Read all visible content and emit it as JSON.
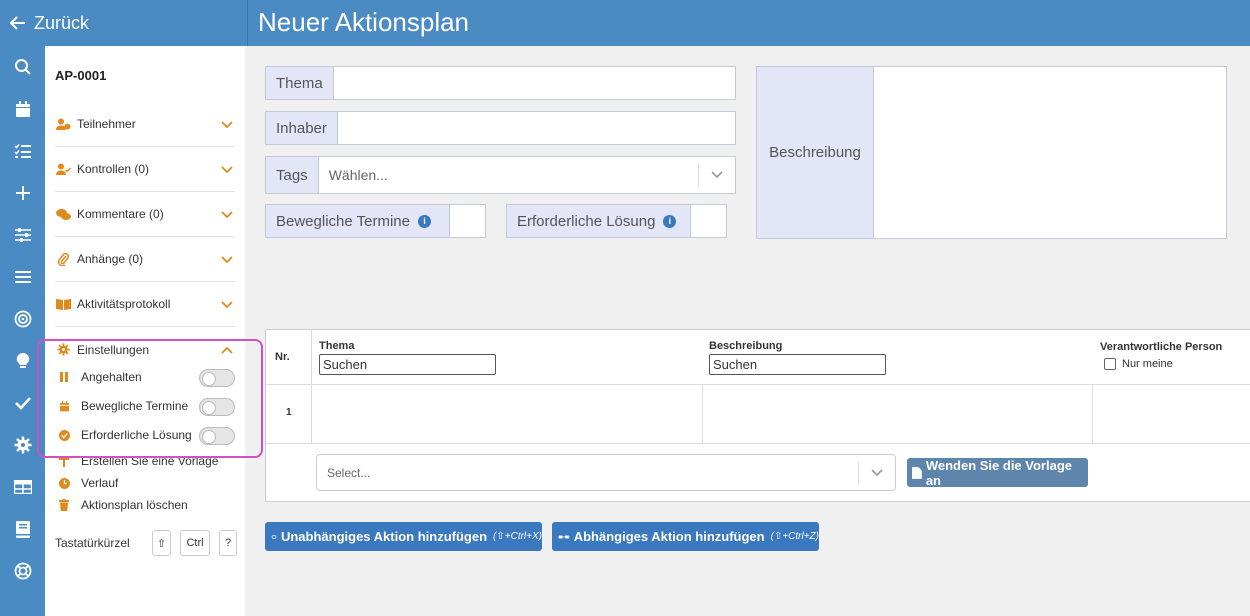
{
  "header": {
    "back_label": "Zurück",
    "title": "Neuer Aktionsplan"
  },
  "rail": {
    "icons": [
      "search-icon",
      "calendar-icon",
      "checklist-icon",
      "plus-icon",
      "sliders-icon",
      "list-icon",
      "target-icon",
      "lightbulb-icon",
      "check-icon",
      "gear-icon",
      "table-icon",
      "book-icon",
      "lifebuoy-icon"
    ]
  },
  "side": {
    "plan_id": "AP-0001",
    "sections": {
      "participants": "Teilnehmer",
      "controls": "Kontrollen (0)",
      "comments": "Kommentare (0)",
      "attachments": "Anhänge (0)",
      "activity": "Aktivitätsprotokoll",
      "settings": "Einstellungen"
    },
    "settings": {
      "paused": "Angehalten",
      "moving_dates": "Bewegliche Termine",
      "required_solution": "Erforderliche Lösung"
    },
    "actions": {
      "create_template": "Erstellen Sie eine Vorlage",
      "history": "Verlauf",
      "delete": "Aktionsplan löschen"
    },
    "shortcuts": {
      "label": "Tastatürkürzel",
      "shift": "⇧",
      "ctrl": "Ctrl",
      "help": "?"
    }
  },
  "form": {
    "topic_label": "Thema",
    "owner_label": "Inhaber",
    "tags_label": "Tags",
    "tags_placeholder": "Wählen...",
    "moving_dates_label": "Bewegliche Termine",
    "required_solution_label": "Erforderliche Lösung",
    "description_label": "Beschreibung"
  },
  "table": {
    "col_nr": "Nr.",
    "col_topic": "Thema",
    "col_description": "Beschreibung",
    "col_responsible": "Verantwortliche Person",
    "search_placeholder": "Suchen",
    "only_mine": "Nur meine",
    "row_number": "1",
    "template_select_placeholder": "Select...",
    "apply_template": "Wenden Sie die Vorlage an"
  },
  "buttons": {
    "add_independent": "Unabhängiges Aktion hinzufügen",
    "add_independent_shortcut": "(⇧+Ctrl+X)",
    "add_dependent": "Abhängiges Aktion hinzufügen",
    "add_dependent_shortcut": "(⇧+Ctrl+Z)"
  },
  "colors": {
    "primary": "#4a8bc4",
    "accent_orange": "#e08a1e",
    "highlight": "#d44fbf"
  }
}
